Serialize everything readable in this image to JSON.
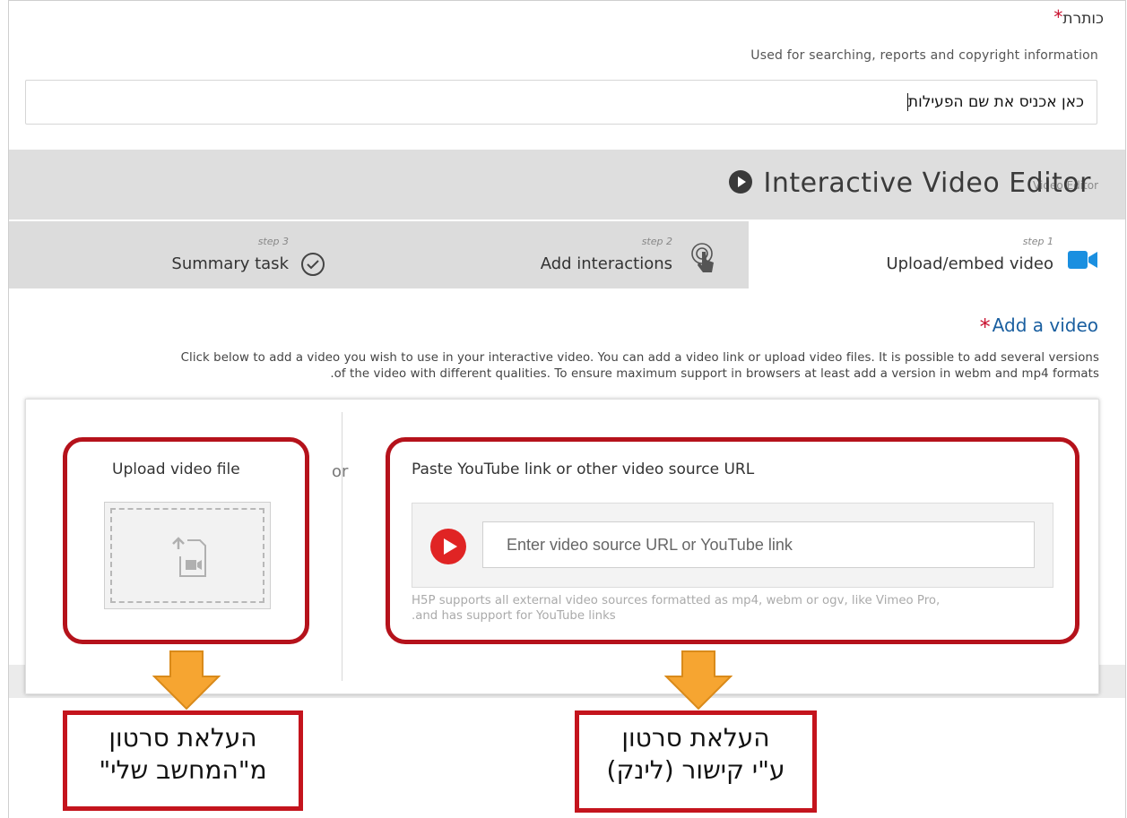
{
  "title_field": {
    "label": "כותרת",
    "required_mark": "*",
    "description": "Used for searching, reports and copyright information",
    "value": "כאן אכניס את שם הפעילות"
  },
  "editor": {
    "title": "Interactive Video Editor",
    "ghost_text": "Video Editor"
  },
  "steps": [
    {
      "num": "step 1",
      "label": "Upload/embed video",
      "icon": "video-camera-icon",
      "active": true
    },
    {
      "num": "step 2",
      "label": "Add interactions",
      "icon": "tap-hand-icon",
      "active": false
    },
    {
      "num": "step 3",
      "label": "Summary task",
      "icon": "check-circle-icon",
      "active": false
    }
  ],
  "add_video": {
    "label": "Add a video",
    "required_mark": "*",
    "description_line1": "Click below to add a video you wish to use in your interactive video. You can add a video link or upload video files. It is possible to add several versions",
    "description_line2": ".of the video with different qualities. To ensure maximum support in browsers at least add a version in webm and mp4 formats"
  },
  "upload": {
    "title": "Upload video file",
    "or": "or"
  },
  "paste": {
    "title": "Paste YouTube link or other video source URL",
    "placeholder": "Enter video source URL or YouTube link",
    "support_line1": "H5P supports all external video sources formatted as mp4, webm or ogv, like Vimeo Pro,",
    "support_line2": ".and has support for YouTube links"
  },
  "annotations": {
    "left_line1": "העלאת סרטון",
    "left_line2": "מ\"המחשב שלי\"",
    "right_line1": "העלאת סרטון",
    "right_line2": "ע\"י קישור (לינק)"
  },
  "colors": {
    "highlight": "#b5121b",
    "arrow": "#f6a531",
    "accent_blue": "#1a5fa0",
    "video_icon": "#1a8fe0"
  }
}
